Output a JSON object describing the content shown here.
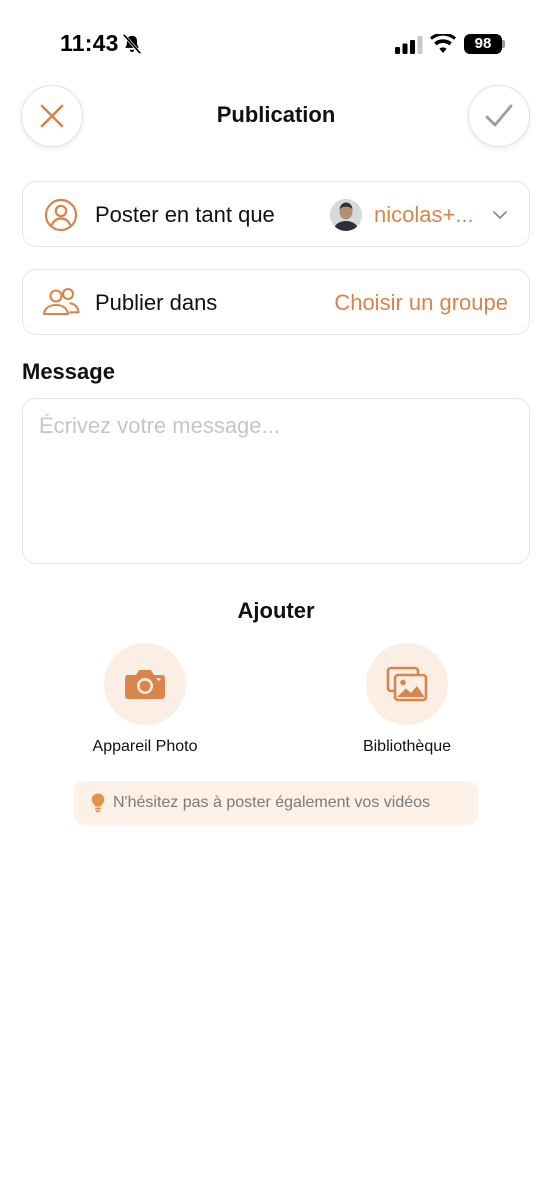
{
  "status_bar": {
    "time": "11:43",
    "battery": "98",
    "icons": [
      "bell-muted-icon",
      "signal-icon",
      "wifi-icon",
      "battery-icon"
    ]
  },
  "header": {
    "title": "Publication",
    "close_icon": "close-icon",
    "confirm_icon": "checkmark-icon"
  },
  "poster_row": {
    "icon": "user-circle-icon",
    "label": "Poster en tant que",
    "account": "nicolas+...",
    "chevron_icon": "chevron-down-icon"
  },
  "group_row": {
    "icon": "users-group-icon",
    "label": "Publier dans",
    "action": "Choisir un groupe"
  },
  "message": {
    "label": "Message",
    "placeholder": "Écrivez votre message...",
    "value": ""
  },
  "add_section": {
    "title": "Ajouter",
    "items": [
      {
        "label": "Appareil Photo",
        "icon": "camera-icon"
      },
      {
        "label": "Bibliothèque",
        "icon": "image-gallery-icon"
      }
    ]
  },
  "tip": {
    "icon": "lightbulb-icon",
    "text": "N'hésitez pas à poster également vos vidéos"
  },
  "colors": {
    "accent": "#D9844B",
    "accent_light": "#FBEEE4",
    "tip_background": "#FDF1E7",
    "border": "#E5E5E5",
    "placeholder": "#C6C6C6"
  }
}
